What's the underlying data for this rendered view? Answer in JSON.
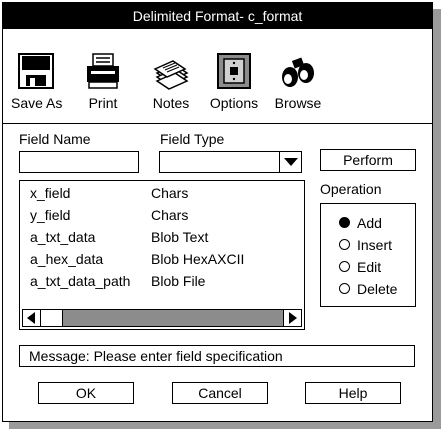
{
  "window": {
    "title": "Delimited Format- c_format"
  },
  "toolbar": {
    "items": [
      {
        "label": "Save As",
        "icon": "floppy-disk-icon"
      },
      {
        "label": "Print",
        "icon": "printer-icon"
      },
      {
        "label": "Notes",
        "icon": "notes-stack-icon"
      },
      {
        "label": "Options",
        "icon": "options-switch-icon"
      },
      {
        "label": "Browse",
        "icon": "binoculars-icon"
      }
    ]
  },
  "form": {
    "field_name_label": "Field Name",
    "field_name_value": "",
    "field_type_label": "Field Type",
    "field_type_value": "",
    "perform_label": "Perform"
  },
  "fields_list": {
    "rows": [
      {
        "name": "x_field",
        "type": "Chars"
      },
      {
        "name": "y_field",
        "type": "Chars"
      },
      {
        "name": "a_txt_data",
        "type": "Blob Text"
      },
      {
        "name": "a_hex_data",
        "type": "Blob HexAXCII"
      },
      {
        "name": "a_txt_data_path",
        "type": "Blob File"
      }
    ]
  },
  "operation": {
    "label": "Operation",
    "options": [
      "Add",
      "Insert",
      "Edit",
      "Delete"
    ],
    "selected": "Add"
  },
  "status": {
    "message": "Message: Please enter field specification"
  },
  "footer": {
    "ok_label": "OK",
    "cancel_label": "Cancel",
    "help_label": "Help"
  }
}
